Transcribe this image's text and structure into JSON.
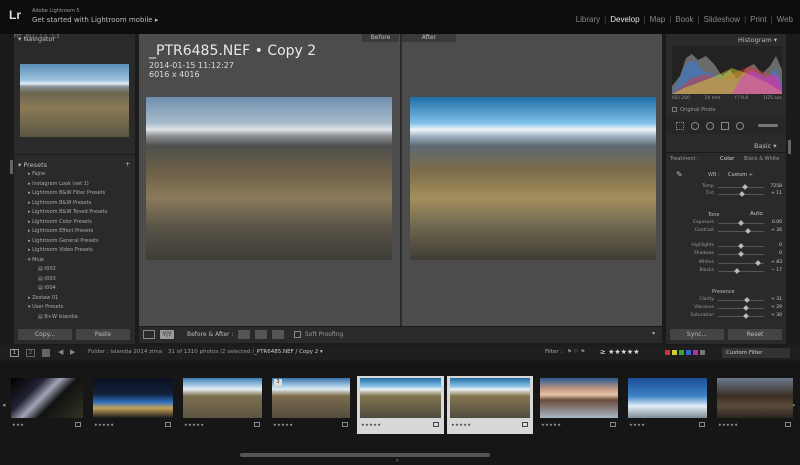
{
  "app": {
    "logo": "Lr",
    "brand_line1": "Adobe Lightroom 5",
    "brand_line2": "Get started with Lightroom mobile ▸"
  },
  "modules": [
    {
      "label": "Library",
      "active": false
    },
    {
      "label": "Develop",
      "active": true
    },
    {
      "label": "Map",
      "active": false
    },
    {
      "label": "Book",
      "active": false
    },
    {
      "label": "Slideshow",
      "active": false
    },
    {
      "label": "Print",
      "active": false
    },
    {
      "label": "Web",
      "active": false
    }
  ],
  "navigator": {
    "title": "Navigator",
    "zoom": [
      "FIT",
      "FILL",
      "1:1",
      "1:3"
    ]
  },
  "presets": {
    "title": "Presets",
    "add": "+",
    "items": [
      "Fajne",
      "Instagram Look (set 1)",
      "Lightroom B&W Filter Presets",
      "Lightroom B&W Presets",
      "Lightroom B&W Toned Presets",
      "Lightroom Color Presets",
      "Lightroom Effect Presets",
      "Lightroom General Presets",
      "Lightroom Video Presets",
      "Moje",
      "t002",
      "t003",
      "t004",
      "Zestaw 01",
      "User Presets",
      "B+W Islandia"
    ]
  },
  "left_buttons": {
    "copy": "Copy...",
    "paste": "Paste"
  },
  "photo": {
    "filename": "_PTR6485.NEF • Copy 2",
    "datetime": "2014-01-15 11:12:27",
    "dimensions": "6016 x 4016",
    "before_label": "Before",
    "after_label": "After"
  },
  "toolbar": {
    "before_after": "Before & After :",
    "soft_proofing": "Soft Proofing"
  },
  "histogram": {
    "title": "Histogram",
    "iso": "ISO 200",
    "focal": "14 mm",
    "aperture": "f / 9.0",
    "shutter": "1/25 sec",
    "original_photo": "Original Photo"
  },
  "basic": {
    "title": "Basic",
    "treatment_label": "Treatment :",
    "color": "Color",
    "bw": "Black & White",
    "wb_label": "WB :",
    "wb_value": "Custom ÷",
    "tone": "Tone",
    "auto": "Auto",
    "presence": "Presence"
  },
  "sliders": [
    {
      "label": "Temp",
      "value": "7258",
      "pos": 0.58
    },
    {
      "label": "Tint",
      "value": "+ 11",
      "pos": 0.52
    },
    {
      "label": "Exposure",
      "value": "0.00",
      "pos": 0.5
    },
    {
      "label": "Contrast",
      "value": "+ 36",
      "pos": 0.66
    },
    {
      "label": "Highlights",
      "value": "0",
      "pos": 0.5
    },
    {
      "label": "Shadows",
      "value": "0",
      "pos": 0.5
    },
    {
      "label": "Whites",
      "value": "+ 83",
      "pos": 0.86
    },
    {
      "label": "Blacks",
      "value": "− 17",
      "pos": 0.42
    },
    {
      "label": "Clarity",
      "value": "+ 31",
      "pos": 0.62
    },
    {
      "label": "Vibrance",
      "value": "+ 29",
      "pos": 0.6
    },
    {
      "label": "Saturation",
      "value": "+ 30",
      "pos": 0.61
    }
  ],
  "right_buttons": {
    "sync": "Sync...",
    "reset": "Reset"
  },
  "filmstrip_bar": {
    "folder": "Folder : Islandia 2014 zima",
    "count": "31 of 1310 photos /2 selected /",
    "file": "_PTR6485.NEF / Copy 2 ▾",
    "filter": "Filter :",
    "stars": "≥ ★★★★★",
    "custom_filter": "Custom Filter"
  },
  "filmstrip": [
    {
      "stars": "★★★",
      "badge": ""
    },
    {
      "stars": "★★★★★",
      "badge": ""
    },
    {
      "stars": "★★★★★",
      "badge": ""
    },
    {
      "stars": "★★★★★",
      "badge": "3"
    },
    {
      "stars": "★★★★★",
      "badge": ""
    },
    {
      "stars": "★★★★★",
      "badge": ""
    },
    {
      "stars": "★★★★★",
      "badge": ""
    },
    {
      "stars": "★★★★",
      "badge": ""
    },
    {
      "stars": "★★★★★",
      "badge": ""
    }
  ]
}
